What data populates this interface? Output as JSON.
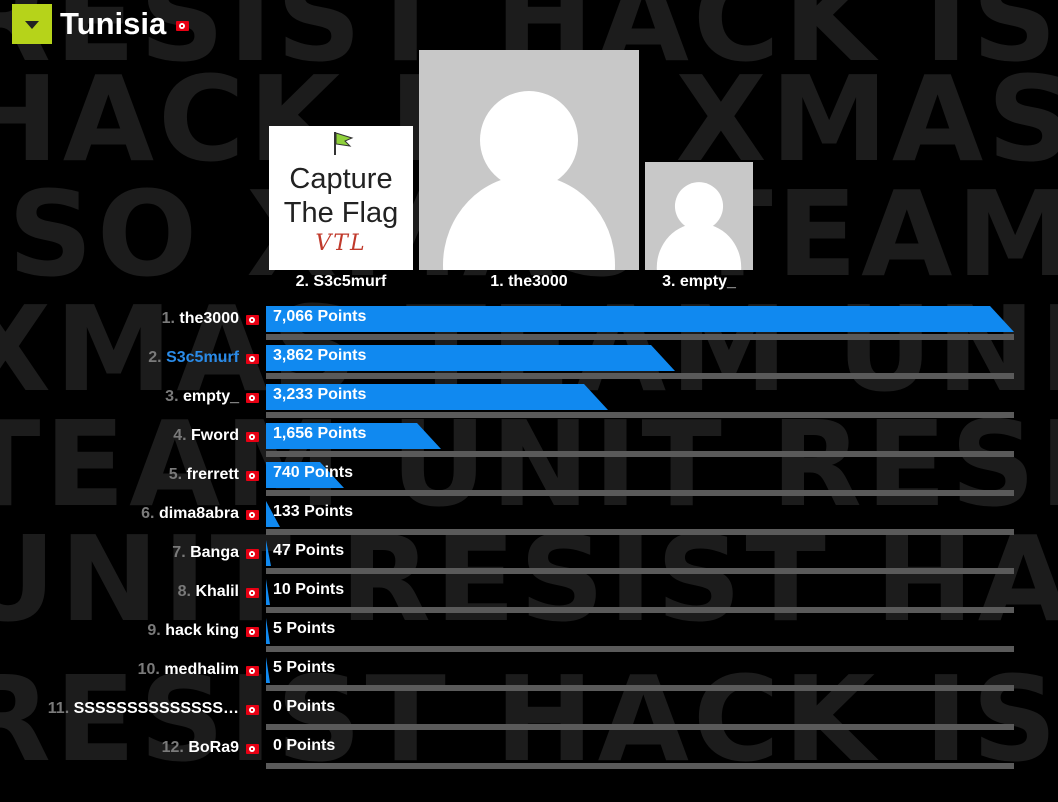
{
  "header": {
    "country": "Tunisia",
    "toggle_icon": "chevron-down-icon",
    "accent": "#b6d31a"
  },
  "background_words": [
    "RESIST HACK ISO",
    "HACK ISO XMAS",
    "ISO XMAS TEAM",
    "XMAS TEAM UNIT",
    "TEAM UNIT RESI",
    "UNIT RESIST HA",
    "RESIST HACK ISO"
  ],
  "podium": {
    "first": {
      "label": "1. the3000",
      "avatar": "default-avatar"
    },
    "second": {
      "label": "2. S3c5murf",
      "avatar": "capture-the-flag-logo",
      "logo_text_1": "Capture",
      "logo_text_2": "The Flag",
      "logo_sig": "VTL"
    },
    "third": {
      "label": "3. empty_",
      "avatar": "default-avatar"
    }
  },
  "bar_color": "#1089f0",
  "highlight_color": "#2a8be8",
  "leaderboard": [
    {
      "rank": "1.",
      "name": "the3000",
      "points_label": "7,066 Points",
      "points": 7066,
      "highlight": false
    },
    {
      "rank": "2.",
      "name": "S3c5murf",
      "points_label": "3,862 Points",
      "points": 3862,
      "highlight": true
    },
    {
      "rank": "3.",
      "name": "empty_",
      "points_label": "3,233 Points",
      "points": 3233,
      "highlight": false
    },
    {
      "rank": "4.",
      "name": "Fword",
      "points_label": "1,656 Points",
      "points": 1656,
      "highlight": false
    },
    {
      "rank": "5.",
      "name": "frerrett",
      "points_label": "740 Points",
      "points": 740,
      "highlight": false
    },
    {
      "rank": "6.",
      "name": "dima8abra",
      "points_label": "133 Points",
      "points": 133,
      "highlight": false
    },
    {
      "rank": "7.",
      "name": "Banga",
      "points_label": "47 Points",
      "points": 47,
      "highlight": false
    },
    {
      "rank": "8.",
      "name": "Khalil",
      "points_label": "10 Points",
      "points": 10,
      "highlight": false
    },
    {
      "rank": "9.",
      "name": "hack king",
      "points_label": "5 Points",
      "points": 5,
      "highlight": false
    },
    {
      "rank": "10.",
      "name": "medhalim",
      "points_label": "5 Points",
      "points": 5,
      "highlight": false
    },
    {
      "rank": "11.",
      "name": "SSSSSSSSSSSSSS…",
      "points_label": "0 Points",
      "points": 0,
      "highlight": false
    },
    {
      "rank": "12.",
      "name": "BoRa9",
      "points_label": "0 Points",
      "points": 0,
      "highlight": false
    }
  ]
}
